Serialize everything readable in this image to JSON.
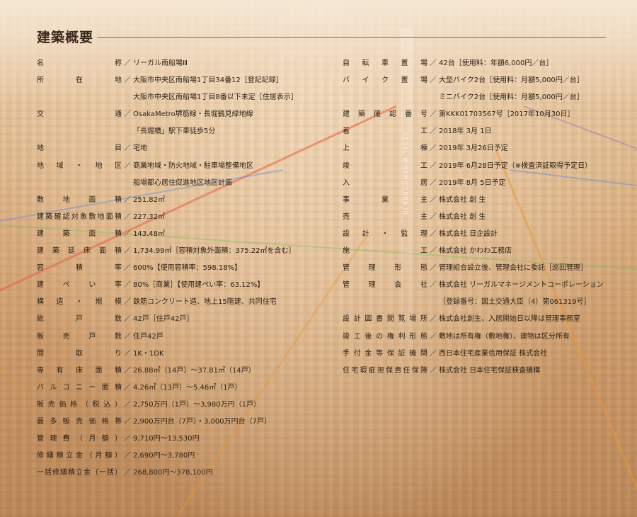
{
  "title": "建築概要",
  "tower_label": "LEGAL MINAMISENBA III",
  "left": [
    {
      "key": "名称",
      "value": "リーガル南船場Ⅲ"
    },
    {
      "key": "所在地",
      "value": "大阪市中央区南船場1丁目34番12［登記記録］"
    },
    {
      "key": "",
      "value": "大阪市中央区南船場1丁目8番以下未定［住居表示］"
    },
    {
      "key": "交通",
      "value": "OsakaMetro堺筋線・長堀鶴見緑地線"
    },
    {
      "key": "",
      "value": "「長堀橋」駅下車徒歩5分"
    },
    {
      "key": "地目",
      "value": "宅地"
    },
    {
      "key": "地域・地区",
      "value": "商業地域・防火地域・駐車場整備地区"
    },
    {
      "key": "",
      "value": "船場都心居住促進地区地区計画"
    },
    {
      "key": "敷地面積",
      "value": "251.82㎡"
    },
    {
      "key": "建築確認対象敷地面積",
      "value": "227.32㎡"
    },
    {
      "key": "建築面積",
      "value": "143.48㎡"
    },
    {
      "key": "建築延床面積",
      "value": "1,734.99㎡［容積対象外面積：375.22㎡を含む］"
    },
    {
      "key": "容積率",
      "value": "600%【使用容積率：598.18%】"
    },
    {
      "key": "建ぺい率",
      "value": "80%［商業］【使用建ぺい率：63.12%】"
    },
    {
      "key": "構造・規模",
      "value": "鉄筋コンクリート造、地上15階建、共同住宅"
    },
    {
      "key": "総戸数",
      "value": "42戸［住戸42戸］"
    },
    {
      "key": "販売戸数",
      "value": "住戸42戸"
    },
    {
      "key": "間取り",
      "value": "1K・1DK"
    },
    {
      "key": "専有床面積",
      "value": "26.88㎡（14戸）〜37.81㎡（14戸）"
    },
    {
      "key": "バルコニー面積",
      "value": "4.26㎡（13戸）〜5.46㎡（1戸）"
    },
    {
      "key": "販売価格（税込）",
      "value": "2,750万円（1戸）〜3,980万円（1戸）"
    },
    {
      "key": "最多販売価格帯",
      "value": "2,900万円台（7戸）・3,000万円台（7戸）"
    },
    {
      "key": "管理費（月額）",
      "value": "9,710円〜13,530円"
    },
    {
      "key": "修繕積立金（月額）",
      "value": "2,690円〜3,780円"
    },
    {
      "key": "一括修繕積立金（一括）",
      "value": "268,800円〜378,100円"
    }
  ],
  "right": [
    {
      "key": "自転車置場",
      "value": "42台［使用料：年額6,000円／台］"
    },
    {
      "key": "バイク置場",
      "value": "大型バイク2台［使用料：月額5,000円／台］"
    },
    {
      "key": "",
      "value": "ミニバイク2台［使用料：月額5,000円／台］"
    },
    {
      "key": "建築確認番号",
      "value": "第KKK01703567号［2017年10月30日］"
    },
    {
      "key": "着工",
      "value": "2018年 3月 1日"
    },
    {
      "key": "上棟",
      "value": "2019年 3月26日予定"
    },
    {
      "key": "竣工",
      "value": "2019年 6月28日予定（※検査済証取得予定日）"
    },
    {
      "key": "入居",
      "value": "2019年 8月 5日予定"
    },
    {
      "key": "事業主",
      "value": "株式会社 創 生"
    },
    {
      "key": "売主",
      "value": "株式会社 創 生"
    },
    {
      "key": "設計・監理",
      "value": "株式会社 日企設計"
    },
    {
      "key": "施工",
      "value": "株式会社 かわわ工務店"
    },
    {
      "key": "管理形態",
      "value": "管理組合設立後、管理会社に委託［巡回管理］"
    },
    {
      "key": "管理会社",
      "value": "株式会社 リーガルマネージメントコーポレーション"
    },
    {
      "key": "",
      "value": "［登録番号：国土交通大臣（4）第061319号］"
    },
    {
      "key": "設計図書閲覧場所",
      "value": "株式会社創生、入居開始日以降は管理事務室"
    },
    {
      "key": "竣工後の権利形態",
      "value": "敷地は所有権（敷地権）、建物は区分所有"
    },
    {
      "key": "手付金等保証機関",
      "value": "西日本住宅産業信用保証 株式会社"
    },
    {
      "key": "住宅瑕疵担保責任保険",
      "value": "株式会社 日本住宅保証検査機構"
    }
  ]
}
